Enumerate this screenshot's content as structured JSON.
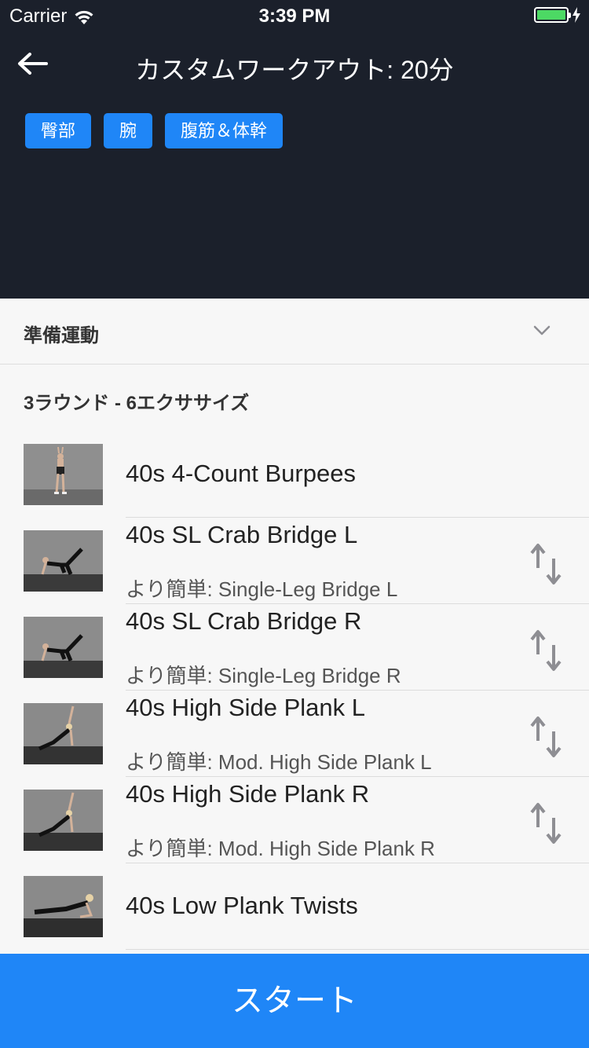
{
  "status_bar": {
    "carrier": "Carrier",
    "time": "3:39 PM",
    "battery_level": 1.0
  },
  "header": {
    "title": "カスタムワークアウト: 20分",
    "tags": [
      "臀部",
      "腕",
      "腹筋＆体幹"
    ]
  },
  "warmup": {
    "label": "準備運動"
  },
  "circuit": {
    "label": "3ラウンド - 6エクササイズ"
  },
  "exercises": [
    {
      "name": "40s 4-Count Burpees",
      "easier": "",
      "swappable": false
    },
    {
      "name": "40s SL Crab Bridge L",
      "easier": "より簡単: Single-Leg Bridge L",
      "swappable": true
    },
    {
      "name": "40s SL Crab Bridge R",
      "easier": "より簡単: Single-Leg Bridge R",
      "swappable": true
    },
    {
      "name": "40s High Side Plank L",
      "easier": "より簡単: Mod. High Side Plank L",
      "swappable": true
    },
    {
      "name": "40s High Side Plank R",
      "easier": "より簡単: Mod. High Side Plank R",
      "swappable": true
    },
    {
      "name": "40s Low Plank Twists",
      "easier": "",
      "swappable": false
    }
  ],
  "start_button": {
    "label": "スタート"
  },
  "icons": {
    "back": "arrow-left-icon",
    "warmup": "chevron-down-icon",
    "swap": "swap-vertical-icon"
  },
  "colors": {
    "header_bg": "#1b202b",
    "accent": "#1f86f7",
    "battery": "#4cd964"
  }
}
